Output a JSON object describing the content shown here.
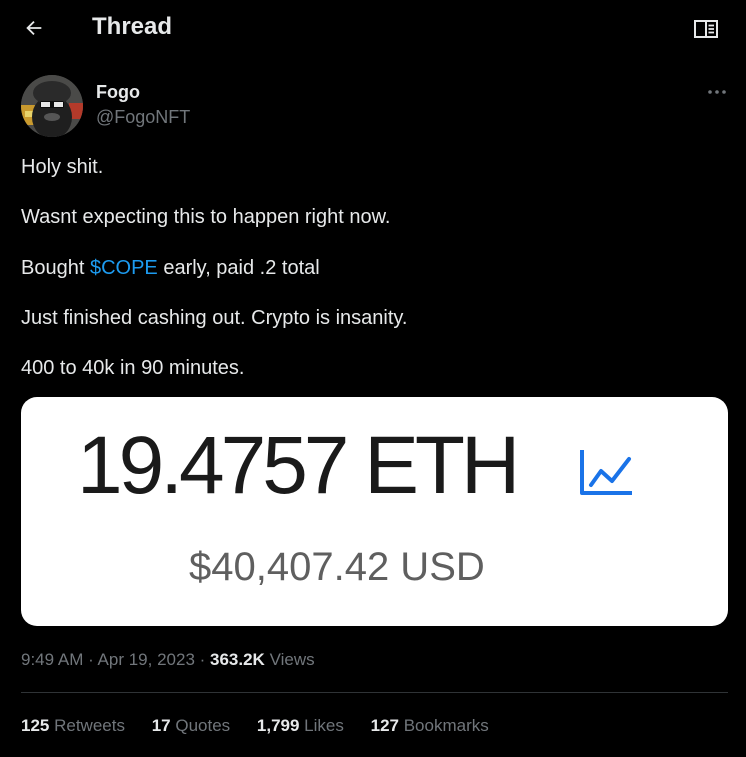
{
  "header": {
    "title": "Thread",
    "back_icon": "arrow-left-icon",
    "reader_icon": "book-open-icon"
  },
  "author": {
    "display_name": "Fogo",
    "handle": "@FogoNFT",
    "more_icon": "ellipsis-icon"
  },
  "tweet": {
    "lines": [
      "Holy shit.",
      "Wasnt expecting this to happen right now.",
      "Just finished cashing out. Crypto is insanity.",
      "400 to 40k in 90 minutes."
    ],
    "bought_prefix": "Bought ",
    "cashtag": "$COPE",
    "bought_suffix": " early, paid .2 total"
  },
  "media": {
    "eth_amount": "19.4757 ETH",
    "usd_amount": "$40,407.42 USD",
    "chart_icon": "line-chart-icon"
  },
  "meta": {
    "time": "9:49 AM",
    "separator": " · ",
    "date": "Apr 19, 2023",
    "views_count": "363.2K",
    "views_label": " Views"
  },
  "stats": [
    {
      "count": "125",
      "label": " Retweets"
    },
    {
      "count": "17",
      "label": " Quotes"
    },
    {
      "count": "1,799",
      "label": " Likes"
    },
    {
      "count": "127",
      "label": " Bookmarks"
    }
  ],
  "colors": {
    "background": "#000000",
    "text": "#e7e9ea",
    "secondary_text": "#71767b",
    "accent": "#1d9bf0",
    "divider": "#2f3336"
  }
}
